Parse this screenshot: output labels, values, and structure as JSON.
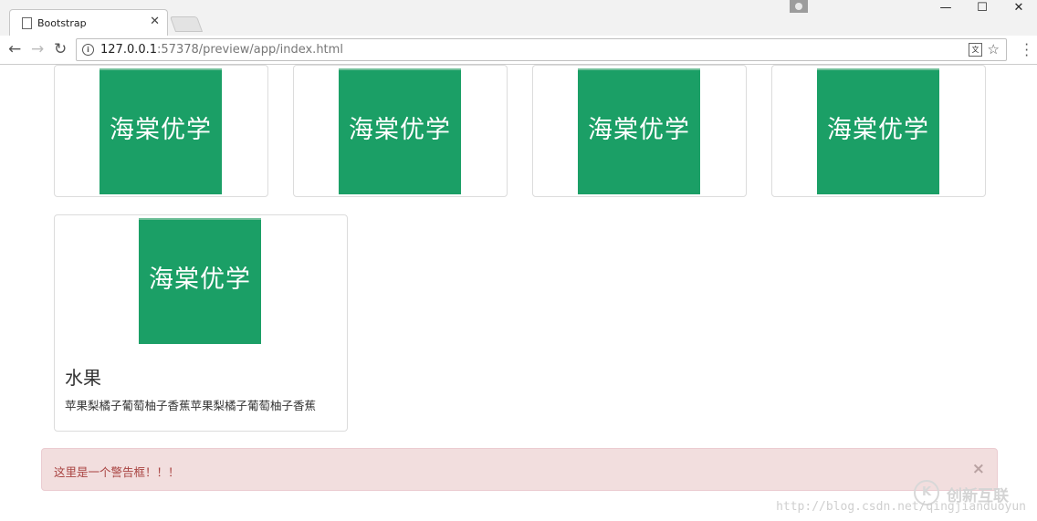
{
  "browser": {
    "tab_title": "Bootstrap",
    "url_host": "127.0.0.1",
    "url_rest": ":57378/preview/app/index.html"
  },
  "thumbnails": [
    {
      "logo_text": "海棠优学"
    },
    {
      "logo_text": "海棠优学"
    },
    {
      "logo_text": "海棠优学"
    },
    {
      "logo_text": "海棠优学"
    }
  ],
  "captioned_thumbnail": {
    "logo_text": "海棠优学",
    "title": "水果",
    "text": "苹果梨橘子葡萄柚子香蕉苹果梨橘子葡萄柚子香蕉"
  },
  "alert": {
    "message": "这里是一个警告框！！！",
    "close": "×"
  },
  "watermark": {
    "url": "http://blog.csdn.net/qingjianduoyun",
    "logo_text": "创新互联",
    "logo_mark": "K"
  }
}
